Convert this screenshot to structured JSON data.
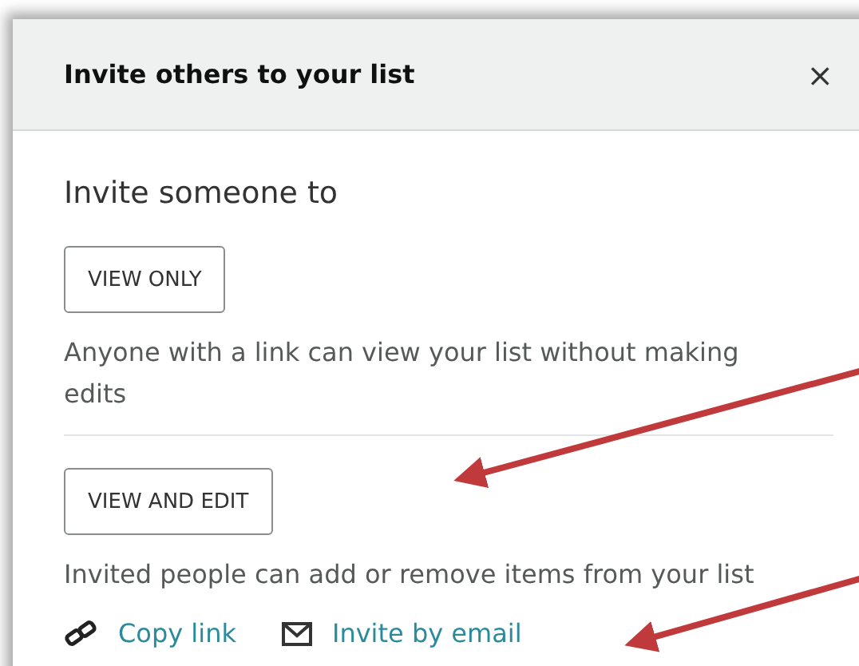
{
  "dialog": {
    "title": "Invite others to your list",
    "close": "×"
  },
  "heading": "Invite someone to",
  "options": [
    {
      "button": "VIEW ONLY",
      "description": "Anyone with a link can view your list without making edits"
    },
    {
      "button": "VIEW AND EDIT",
      "description": "Invited people can add or remove items from your list"
    }
  ],
  "links": [
    {
      "kind": "link",
      "label": "Copy link"
    },
    {
      "kind": "email",
      "label": "Invite by email"
    }
  ],
  "annotations": [
    {
      "kind": "arrow"
    },
    {
      "kind": "arrow"
    }
  ]
}
